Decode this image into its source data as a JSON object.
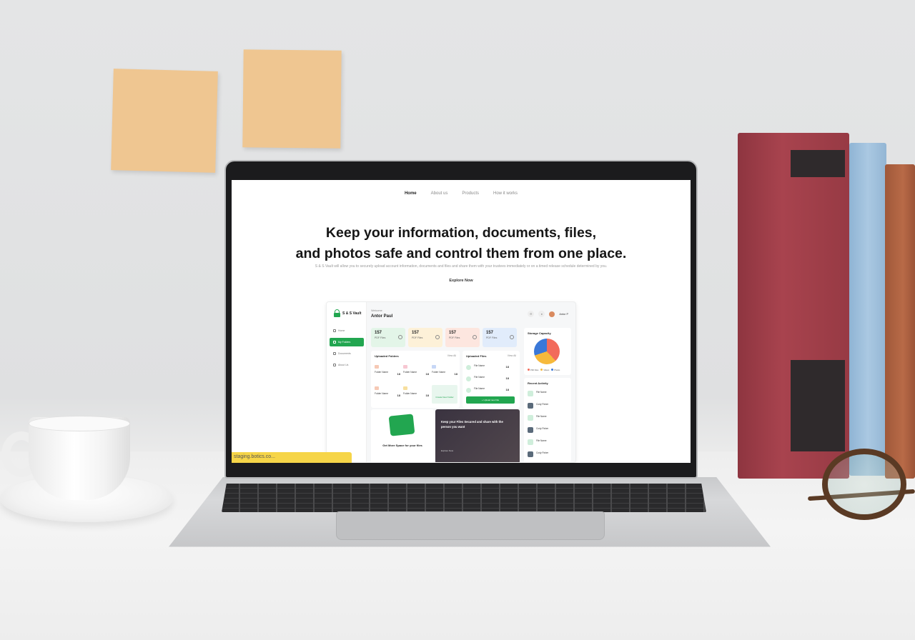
{
  "site": {
    "nav": [
      "Home",
      "About us",
      "Products",
      "How it works"
    ],
    "hero_line1": "Keep your information, documents, files,",
    "hero_line2": "and photos safe and control them from one place.",
    "hero_sub": "S & S Vault will allow you to securely upload account information, documents and files and share them with your trustees immediately or on a timed release schedule determined by you.",
    "cta": "Explore Now"
  },
  "dashboard": {
    "brand": "S & S Vault",
    "sidebar": [
      "Home",
      "My Folders",
      "Documents",
      "About Us"
    ],
    "welcome": "Welcome",
    "user": "Antor Paul",
    "user_short": "Antor P",
    "stats": [
      {
        "num": "157",
        "label": "PDF Files",
        "color": "#e3f5e8"
      },
      {
        "num": "157",
        "label": "PDF Files",
        "color": "#fdf1d8"
      },
      {
        "num": "157",
        "label": "PDF Files",
        "color": "#fde6df"
      },
      {
        "num": "157",
        "label": "PDF Files",
        "color": "#e1ecfb"
      }
    ],
    "uploaded_folders": {
      "title": "Uploaded Folders",
      "view_all": "View All",
      "items": [
        {
          "name": "Folder Name",
          "count": "18",
          "color": "#f6c9b5"
        },
        {
          "name": "Folder Name",
          "count": "18",
          "color": "#f7c7d2"
        },
        {
          "name": "Folder Name",
          "count": "18",
          "color": "#c7d7f6"
        },
        {
          "name": "Folder Name",
          "count": "18",
          "color": "#f6c9b5"
        },
        {
          "name": "Folder Name",
          "count": "18",
          "color": "#f7df9e"
        }
      ],
      "new_folder": "Create New Folder"
    },
    "uploaded_files": {
      "title": "Uploaded Files",
      "view_all": "View All",
      "items": [
        {
          "name": "File Name",
          "size": "18"
        },
        {
          "name": "File Name",
          "size": "18"
        },
        {
          "name": "File Name",
          "size": "18"
        }
      ],
      "upload_label": "+ Upload new File"
    },
    "storage": {
      "title": "Storage Capacity",
      "legend": [
        "PDF Files",
        "Videos",
        "Photos"
      ]
    },
    "recent": {
      "title": "Recent Activity",
      "items": [
        "File Name",
        "Cody Fisher",
        "File Name",
        "Cody Fisher",
        "File Name",
        "Cody Fisher"
      ]
    },
    "promo_white": "Get More Space for your files",
    "promo_dark": "Keep your Files Secured and share with the person you want",
    "promo_dark_link": "Explore Now"
  },
  "status_url": "staging.botics.co..."
}
